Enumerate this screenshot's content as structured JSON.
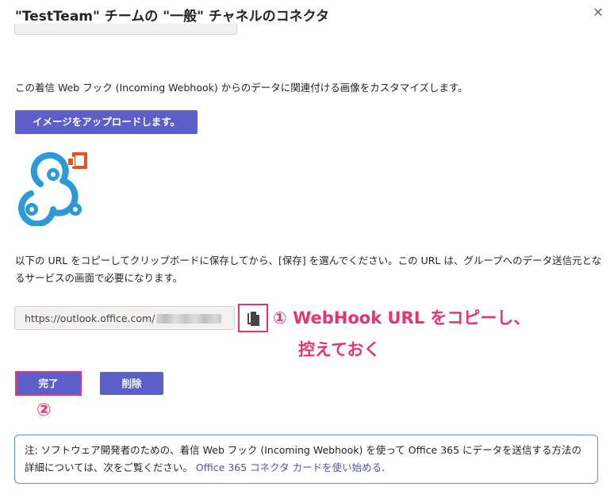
{
  "dialog": {
    "title": "\"TestTeam\" チームの \"一般\" チャネルのコネクタ",
    "close_icon": "close-icon"
  },
  "description": "この着信 Web フック (Incoming Webhook) からのデータに関連付ける画像をカスタマイズします。",
  "upload_button": "イメージをアップロードします。",
  "logo": {
    "icon": "webhook-logo",
    "badge_color": "#e8501f",
    "ring_color": "#2c9ad6"
  },
  "instructions": "以下の URL をコピーしてクリップボードに保存してから、[保存] を選んでください。この URL は、グループへのデータ送信元となるサービスの画面で必要になります。",
  "url_field": {
    "value": "https://outlook.office.com/"
  },
  "copy_button": {
    "icon": "copy-icon"
  },
  "annotation_1": {
    "line1": "① WebHook URL をコピーし、",
    "line2": "控えておく"
  },
  "annotation_2": "②",
  "done_button": "完了",
  "delete_button": "削除",
  "note": {
    "text": "注: ソフトウェア開発者のための、着信 Web フック (Incoming Webhook) を使って Office 365 にデータを送信する方法の詳細については、次をご覧ください。",
    "link": "Office 365 コネクタ カードを使い始める",
    "end": "."
  },
  "colors": {
    "accent": "#5b5fc7",
    "annotation": "#e8336f",
    "note_border": "#5b8fd6"
  }
}
